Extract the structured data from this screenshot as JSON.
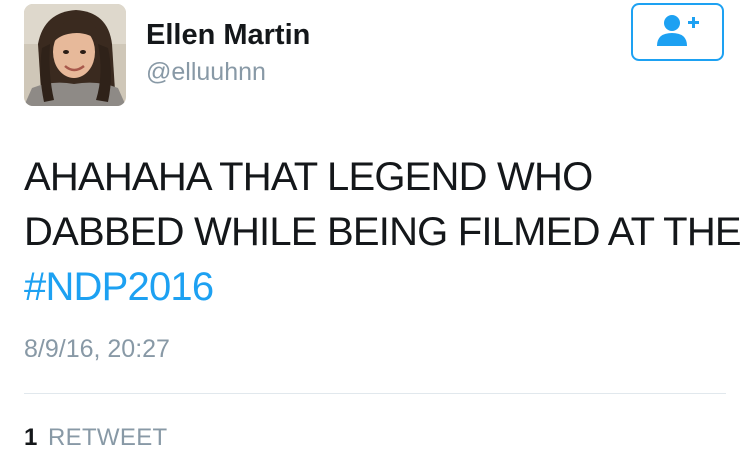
{
  "user": {
    "display_name": "Ellen Martin",
    "handle": "@elluuhnn",
    "avatar_icon": "profile-photo"
  },
  "follow_button": {
    "icon": "follow-user-plus-icon",
    "accent_color": "#1da1f2"
  },
  "tweet": {
    "line1": "AHAHAHA THAT LEGEND WHO",
    "line2": "DABBED WHILE BEING FILMED AT THE",
    "hashtag": "#NDP2016",
    "timestamp": "8/9/16, 20:27"
  },
  "stats": {
    "retweet_count": "1",
    "retweet_label": "RETWEET"
  },
  "colors": {
    "link": "#1da1f2",
    "secondary_text": "#8899a6",
    "primary_text": "#14171a"
  }
}
